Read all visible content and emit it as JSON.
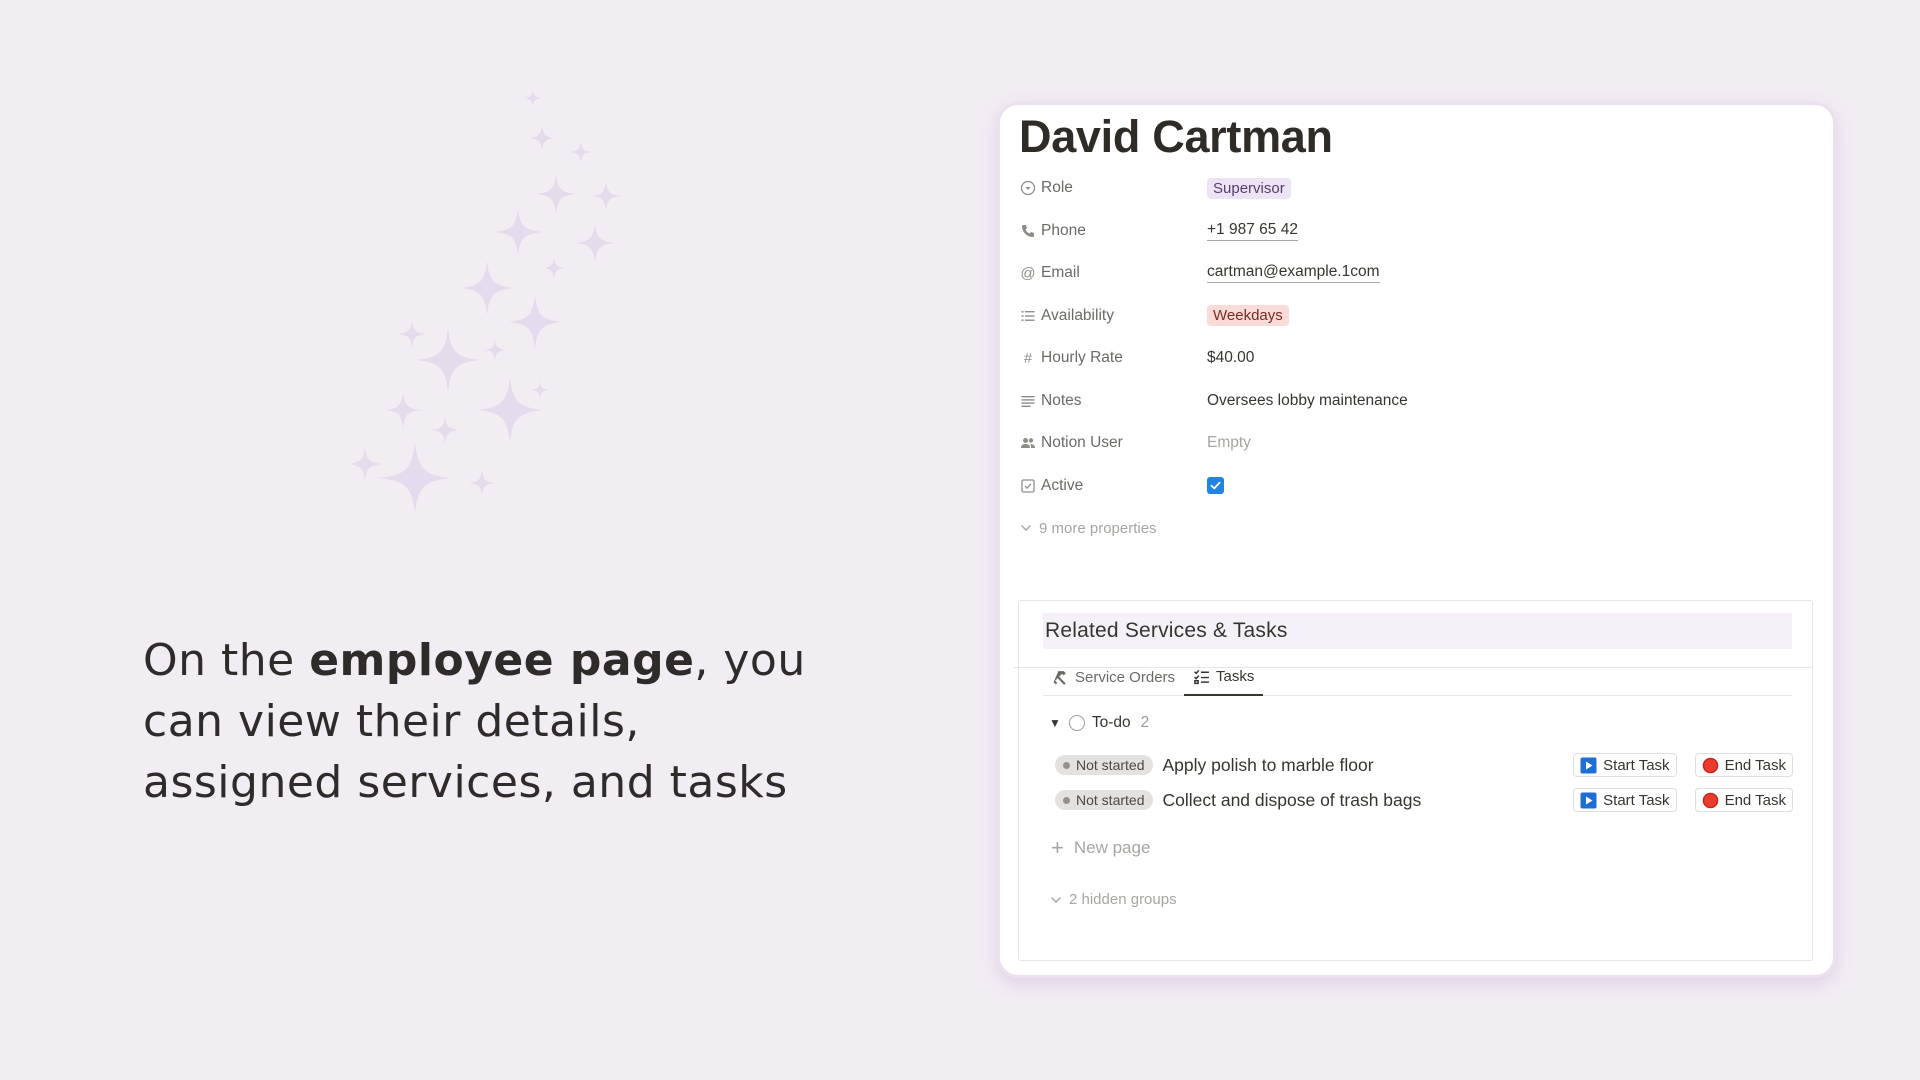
{
  "caption": {
    "before": "On the ",
    "bold": "employee page",
    "after": ", you can view their details, assigned services, and tasks"
  },
  "employee": {
    "name": "David Cartman",
    "properties": [
      {
        "icon": "role-icon",
        "label": "Role",
        "value": "Supervisor",
        "style": "tag-purple"
      },
      {
        "icon": "phone-icon",
        "label": "Phone",
        "value": "+1 987 65 42",
        "style": "underline"
      },
      {
        "icon": "at-icon",
        "label": "Email",
        "value": "cartman@example.1com",
        "style": "underline"
      },
      {
        "icon": "list-icon",
        "label": "Availability",
        "value": "Weekdays",
        "style": "tag-red"
      },
      {
        "icon": "hash-icon",
        "label": "Hourly Rate",
        "value": "$40.00",
        "style": "plain"
      },
      {
        "icon": "text-lines-icon",
        "label": "Notes",
        "value": "Oversees lobby maintenance",
        "style": "plain"
      },
      {
        "icon": "people-icon",
        "label": "Notion User",
        "value": "Empty",
        "style": "muted"
      },
      {
        "icon": "checkbox-icon",
        "label": "Active",
        "value": "",
        "checked": true
      }
    ],
    "more_properties": "9 more properties"
  },
  "related": {
    "title": "Related Services & Tasks",
    "tabs": [
      {
        "label": "Service Orders",
        "icon": "hammer-icon",
        "active": false
      },
      {
        "label": "Tasks",
        "icon": "checklist-icon",
        "active": true
      }
    ],
    "group": {
      "label": "To-do",
      "count": "2"
    },
    "tasks": [
      {
        "status": "Not started",
        "title": "Apply polish to marble floor"
      },
      {
        "status": "Not started",
        "title": "Collect and dispose of trash bags"
      }
    ],
    "buttons": {
      "start": "Start Task",
      "end": "End Task"
    },
    "new_page": "New page",
    "hidden_groups": "2 hidden groups"
  },
  "colors": {
    "background": "#f2ecf3",
    "accent_purple": "#ece3f4",
    "accent_red": "#fadbd7",
    "checkbox_blue": "#2383e2"
  }
}
